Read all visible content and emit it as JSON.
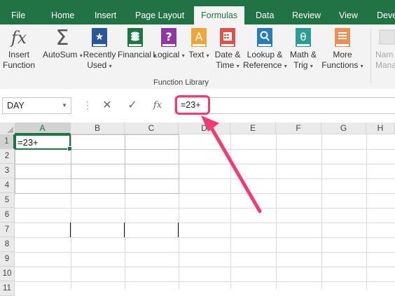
{
  "tabs": [
    "File",
    "Home",
    "Insert",
    "Page Layout",
    "Formulas",
    "Data",
    "Review",
    "View",
    "Deve"
  ],
  "active_tab": "Formulas",
  "ribbon": {
    "insert_function": [
      "Insert",
      "Function"
    ],
    "autosum": "AutoSum",
    "recently_used": [
      "Recently",
      "Used"
    ],
    "financial": "Financial",
    "logical": "Logical",
    "text": "Text",
    "date_time": [
      "Date &",
      "Time"
    ],
    "lookup_reference": [
      "Lookup &",
      "Reference"
    ],
    "math_trig": [
      "Math &",
      "Trig"
    ],
    "more_functions": [
      "More",
      "Functions"
    ],
    "name_manager": [
      "Nam",
      "Mana"
    ],
    "group_label": "Function Library",
    "icon_colors": {
      "green": "#217346",
      "accent_pink": "#f23a75"
    }
  },
  "formula_bar": {
    "name_box": "DAY",
    "cancel_icon": "✕",
    "enter_icon": "✓",
    "fx_icon": "fx",
    "formula": "=23+"
  },
  "grid": {
    "columns": [
      "A",
      "B",
      "C",
      "D",
      "E",
      "F",
      "G",
      "H"
    ],
    "rows": [
      "1",
      "2",
      "3",
      "4",
      "5",
      "6",
      "7",
      "8",
      "9",
      "10",
      "11"
    ],
    "active_cell": "A1",
    "cell_a1": "=23+"
  }
}
